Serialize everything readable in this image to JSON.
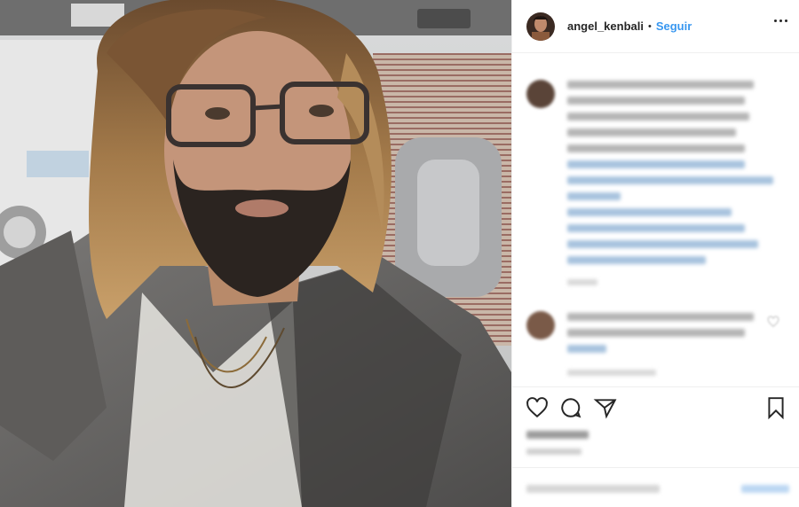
{
  "post": {
    "author": {
      "username": "angel_kenbali",
      "avatar": "profile-photo"
    },
    "separator": "•",
    "follow_label": "Seguir",
    "more_icon": "more-options-icon",
    "photo": {
      "subject": "man-with-glasses-selfie"
    }
  },
  "comments_section": {
    "caption_blurred": true,
    "comment_blurred": true
  },
  "actions": {
    "icons": [
      "heart-icon",
      "comment-icon",
      "share-icon",
      "bookmark-icon"
    ]
  },
  "colors": {
    "accent": "#3897f0",
    "text": "#262626",
    "border": "#efefef"
  }
}
